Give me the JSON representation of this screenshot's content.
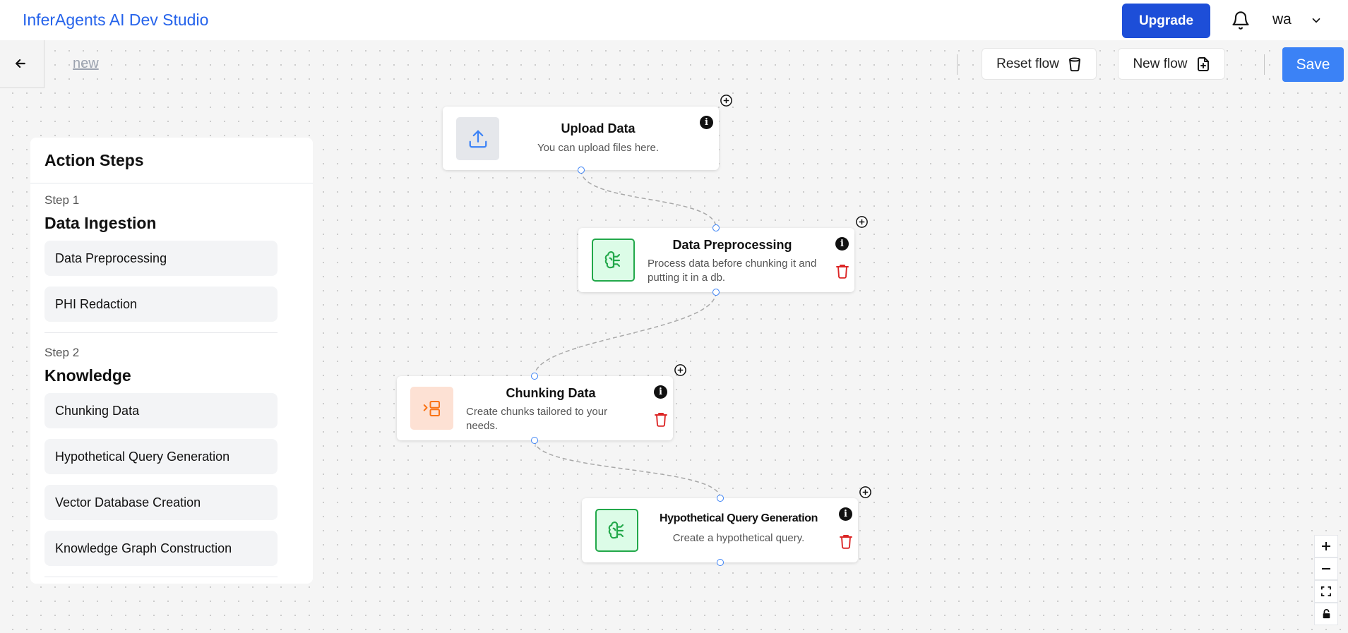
{
  "header": {
    "brand": "InferAgents AI Dev Studio",
    "upgrade_label": "Upgrade",
    "user_initials": "wa"
  },
  "toolbar": {
    "flow_name": "new",
    "reset_label": "Reset flow",
    "new_label": "New flow",
    "save_label": "Save"
  },
  "action_steps": {
    "title": "Action Steps",
    "steps": [
      {
        "label": "Step 1",
        "title": "Data Ingestion",
        "items": [
          "Data Preprocessing",
          "PHI Redaction"
        ]
      },
      {
        "label": "Step 2",
        "title": "Knowledge",
        "items": [
          "Chunking Data",
          "Hypothetical Query Generation",
          "Vector Database Creation",
          "Knowledge Graph Construction"
        ]
      }
    ]
  },
  "nodes": [
    {
      "title": "Upload Data",
      "description": "You can upload files here.",
      "icon": "upload-icon"
    },
    {
      "title": "Data Preprocessing",
      "description": "Process data before chunking it and putting it in a db.",
      "icon": "brain-icon"
    },
    {
      "title": "Chunking Data",
      "description": "Create chunks tailored to your needs.",
      "icon": "chunks-icon"
    },
    {
      "title": "Hypothetical Query Generation",
      "description": "Create a hypothetical query.",
      "icon": "brain-icon"
    }
  ],
  "colors": {
    "brand": "#2563eb",
    "upgrade": "#1d4ed8",
    "save": "#3b82f6",
    "edge": "#a8a8a8",
    "handle": "#3b82f6",
    "trash": "#dc2626",
    "preprocess_icon": "#22a84a",
    "chunk_icon": "#f97316"
  }
}
